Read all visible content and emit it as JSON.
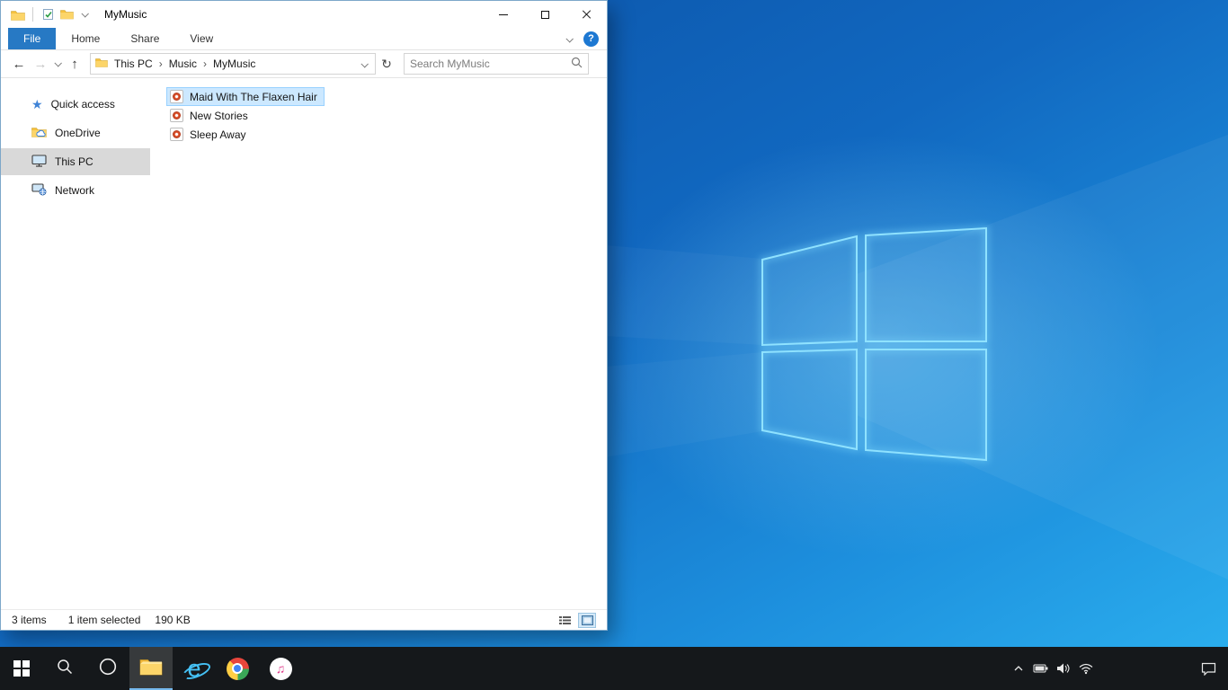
{
  "window": {
    "title": "MyMusic",
    "ribbon_tabs": [
      "File",
      "Home",
      "Share",
      "View"
    ],
    "breadcrumb": [
      "This PC",
      "Music",
      "MyMusic"
    ],
    "search_placeholder": "Search MyMusic",
    "sidebar_items": [
      "Quick access",
      "OneDrive",
      "This PC",
      "Network"
    ],
    "files": [
      "Maid With The Flaxen Hair",
      "New Stories",
      "Sleep Away"
    ],
    "status": {
      "count": "3 items",
      "selected": "1 item selected",
      "size": "190 KB"
    }
  },
  "icons": {
    "back": "←",
    "forward": "→",
    "up": "↑",
    "refresh": "↻",
    "help": "?",
    "quick_access_star": "★",
    "breadcrumb_sep": "›",
    "music_note": "♫"
  },
  "colors": {
    "accent": "#0078d7",
    "file_tab": "#2779c4",
    "selection_bg": "#cce8ff",
    "selection_border": "#99d1ff",
    "taskbar": "#15181b",
    "wallpaper_base": "#0f63b8"
  }
}
